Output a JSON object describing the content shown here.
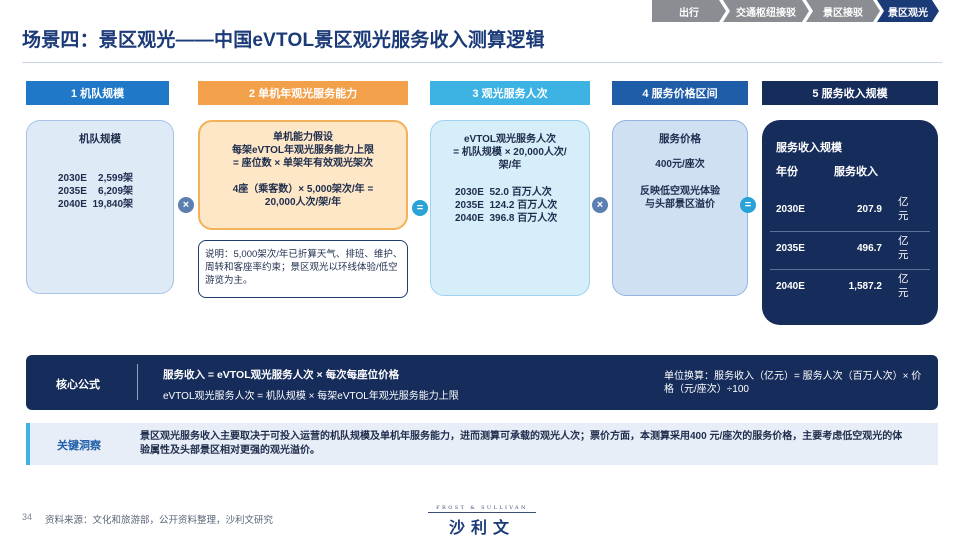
{
  "nav": {
    "tabs": [
      {
        "label": "出行",
        "active": false
      },
      {
        "label": "交通枢纽接驳",
        "active": false
      },
      {
        "label": "景区接驳",
        "active": false
      },
      {
        "label": "景区观光",
        "active": true
      }
    ]
  },
  "page_title": "场景四：景区观光——中国eVTOL景区观光服务收入测算逻辑",
  "steps": [
    {
      "label": "1  机队规模",
      "color": "#1f78c8"
    },
    {
      "label": "2  单机年观光服务能力",
      "color": "#f3a04b"
    },
    {
      "label": "3  观光服务人次",
      "color": "#3db3e3"
    },
    {
      "label": "4  服务价格区间",
      "color": "#1f5da8"
    },
    {
      "label": "5  服务收入规模",
      "color": "#162c5b"
    }
  ],
  "box1": {
    "title": "机队规模",
    "rows": [
      "2030E    2,599架",
      "2035E    6,209架",
      "2040E  19,840架"
    ]
  },
  "box2": {
    "lines": [
      "单机能力假设",
      "每架eVTOL年观光服务能力上限",
      "= 座位数 × 单架年有效观光架次"
    ],
    "calc": [
      "4座（乘客数）× 5,000架次/年 =",
      "20,000人次/架/年"
    ]
  },
  "note": {
    "text": "说明：5,000架次/年已折算天气、排班、维护、周转和客座率约束；景区观光以环线体验/低空游览为主。"
  },
  "box3": {
    "lines": [
      "eVTOL观光服务人次",
      "= 机队规模 × 20,000人次/",
      "架/年"
    ],
    "rows": [
      "2030E  52.0 百万人次",
      "2035E  124.2 百万人次",
      "2040E  396.8 百万人次"
    ]
  },
  "box4": {
    "title": "服务价格",
    "price": "400元/座次",
    "desc": [
      "反映低空观光体验",
      "与头部景区溢价"
    ]
  },
  "box5": {
    "title": "服务收入规模",
    "col_year": "年份",
    "col_rev": "服务收入",
    "rows": [
      {
        "year": "2030E",
        "value": "207.9",
        "unit": "亿元"
      },
      {
        "year": "2035E",
        "value": "496.7",
        "unit": "亿元"
      },
      {
        "year": "2040E",
        "value": "1,587.2",
        "unit": "亿元"
      }
    ]
  },
  "operators": {
    "times": "×",
    "equals": "="
  },
  "formula": {
    "label": "核心公式",
    "main": "服务收入 = eVTOL观光服务人次 × 每次每座位价格",
    "sub": "eVTOL观光服务人次 = 机队规模 × 每架eVTOL年观光服务能力上限",
    "unit": "单位换算：服务收入（亿元）= 服务人次（百万人次）× 价格（元/座次）÷100"
  },
  "insight": {
    "label": "关键洞察",
    "text": "景区观光服务收入主要取决于可投入运营的机队规模及单机年服务能力，进而测算可承载的观光人次；票价方面，本测算采用400 元/座次的服务价格，主要考虑低空观光的体验属性及头部景区相对更强的观光溢价。"
  },
  "footer": {
    "page": "34",
    "source": "资料来源：文化和旅游部，公开资料整理，沙利文研究",
    "logo_en": "FROST & SULLIVAN",
    "logo_cn": "沙利文"
  }
}
